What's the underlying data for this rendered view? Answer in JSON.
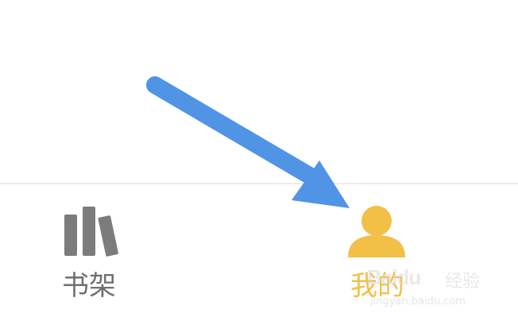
{
  "tabbar": {
    "tabs": [
      {
        "label": "书架",
        "icon": "bookshelf-icon",
        "active": false,
        "color": "#6f6f6f"
      },
      {
        "label": "我的",
        "icon": "user-profile-icon",
        "active": true,
        "color": "#f2c046"
      }
    ]
  },
  "annotation": {
    "arrow_color": "#5094e6",
    "points_to": "tab-mine"
  },
  "watermark": {
    "brand": "Baidu",
    "cn": "经验",
    "url": "jingyan.baidu.com"
  }
}
